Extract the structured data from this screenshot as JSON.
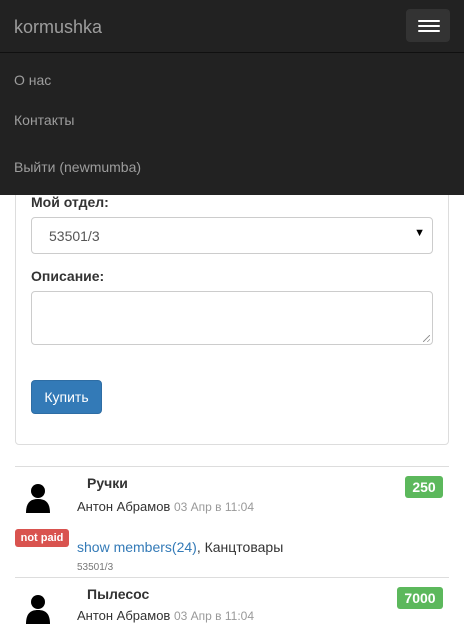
{
  "navbar": {
    "brand": "kormushka",
    "links": [
      "О нас",
      "Контакты",
      "Выйти (newmumba)"
    ]
  },
  "form": {
    "department_label": "Мой отдел:",
    "department_value": "53501/3",
    "description_label": "Описание:",
    "description_value": "",
    "buy_button": "Купить"
  },
  "items": [
    {
      "title": "Ручки",
      "price": "250",
      "author": "Антон Абрамов",
      "date": "03 Апр в 11:04",
      "status": "not paid",
      "members_link": "show members(24)",
      "category": ", Канцтовары",
      "department": "53501/3"
    },
    {
      "title": "Пылесос",
      "price": "7000",
      "author": "Антон Абрамов",
      "date": "03 Апр в 11:04"
    }
  ],
  "colors": {
    "navbar_bg": "#222222",
    "primary": "#337ab7",
    "success": "#5cb85c",
    "danger": "#d9534f"
  }
}
